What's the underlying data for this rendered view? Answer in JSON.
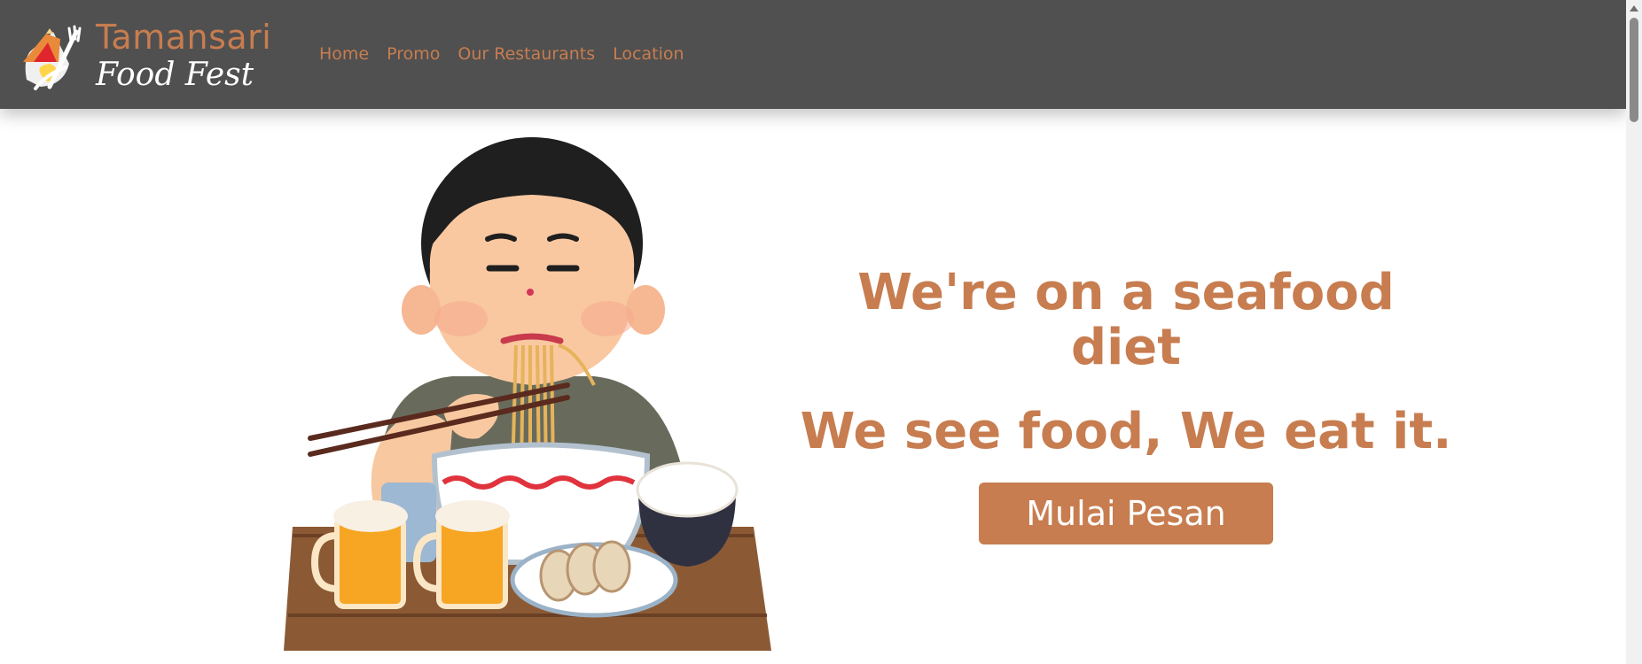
{
  "brand": {
    "title": "Tamansari",
    "subtitle": "Food Fest"
  },
  "nav": {
    "items": [
      "Home",
      "Promo",
      "Our Restaurants",
      "Location"
    ]
  },
  "hero": {
    "line1": {
      "pre": "We're on a ",
      "bold": "seafood",
      "post": " diet"
    },
    "line2": {
      "pre": "We ",
      "bold": "see food",
      "post": ", We eat it."
    },
    "cta_label": "Mulai Pesan"
  },
  "colors": {
    "accent": "#c77d4f",
    "navbar": "#505050",
    "background": "#ffffff"
  },
  "icons": {
    "logo": "tent-fork-logo-icon",
    "illustration": "boy-eating-ramen-illustration"
  }
}
